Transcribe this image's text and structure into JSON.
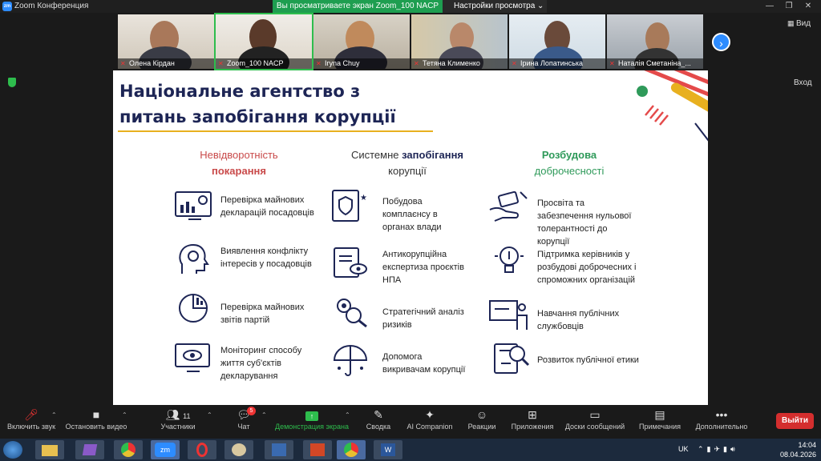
{
  "window": {
    "app_title": "Zoom Конференция",
    "app_icon_text": "zm"
  },
  "share_bar": {
    "banner": "Вы просматриваете экран Zoom_100 NACP",
    "settings": "Настройки просмотра ⌄"
  },
  "participants": [
    {
      "name": "Олена Кірдан"
    },
    {
      "name": "Zoom_100 NACP"
    },
    {
      "name": "Iryna Chuy"
    },
    {
      "name": "Тетяна Клименко"
    },
    {
      "name": "Ірина Лопатинська"
    },
    {
      "name": "Наталія Сметаніна_..."
    }
  ],
  "right_controls": {
    "view": "Вид",
    "exit_fullscreen": "Вход"
  },
  "slide": {
    "title_line1": "Національне агентство з",
    "title_line2": "питань запобігання корупції",
    "columns": [
      {
        "head_line1": "Невідворотність",
        "head_line2": "покарання",
        "color": "#c94a4a",
        "items": [
          "Перевірка майнових декларацій посадовців",
          "Виявлення конфлікту інтересів у посадовців",
          "Перевірка майнових звітів партій",
          "Моніторинг способу життя суб'єктів декларування"
        ]
      },
      {
        "head_line1a": "Системне ",
        "head_line1b": "запобігання",
        "head_line2": "корупції",
        "color": "#1d2555",
        "items": [
          "Побудова комплаєнсу в органах влади",
          "Антикорупційна експертиза проєктів НПА",
          "Стратегічний аналіз ризиків",
          "Допомога викривачам корупції"
        ]
      },
      {
        "head_line1": "Розбудова",
        "head_line2": "доброчесності",
        "color": "#2f9a5a",
        "items": [
          "Просвіта та забезпечення нульової толерантності до корупції",
          "Підтримка керівників у розбудові доброчесних і спроможних організацій",
          "Навчання публічних службовців",
          "Розвиток публічної етики"
        ]
      }
    ]
  },
  "toolbar": {
    "mute": "Включить звук",
    "video": "Остановить видео",
    "participants": "Участники",
    "participants_count": "11",
    "chat": "Чат",
    "chat_badge": "5",
    "share": "Демонстрация экрана",
    "summary": "Сводка",
    "ai": "AI Companion",
    "reactions": "Реакции",
    "apps": "Приложения",
    "whiteboards": "Доски сообщений",
    "notes": "Примечания",
    "more": "Дополнительно",
    "leave": "Выйти"
  },
  "taskbar": {
    "lang": "UK",
    "time": "14:04",
    "date": "08.04.2026"
  },
  "colors": {
    "accent_green": "#1e9e50",
    "zoom_blue": "#2d8cff",
    "leave_red": "#d42e2e",
    "title_navy": "#1d2555"
  }
}
